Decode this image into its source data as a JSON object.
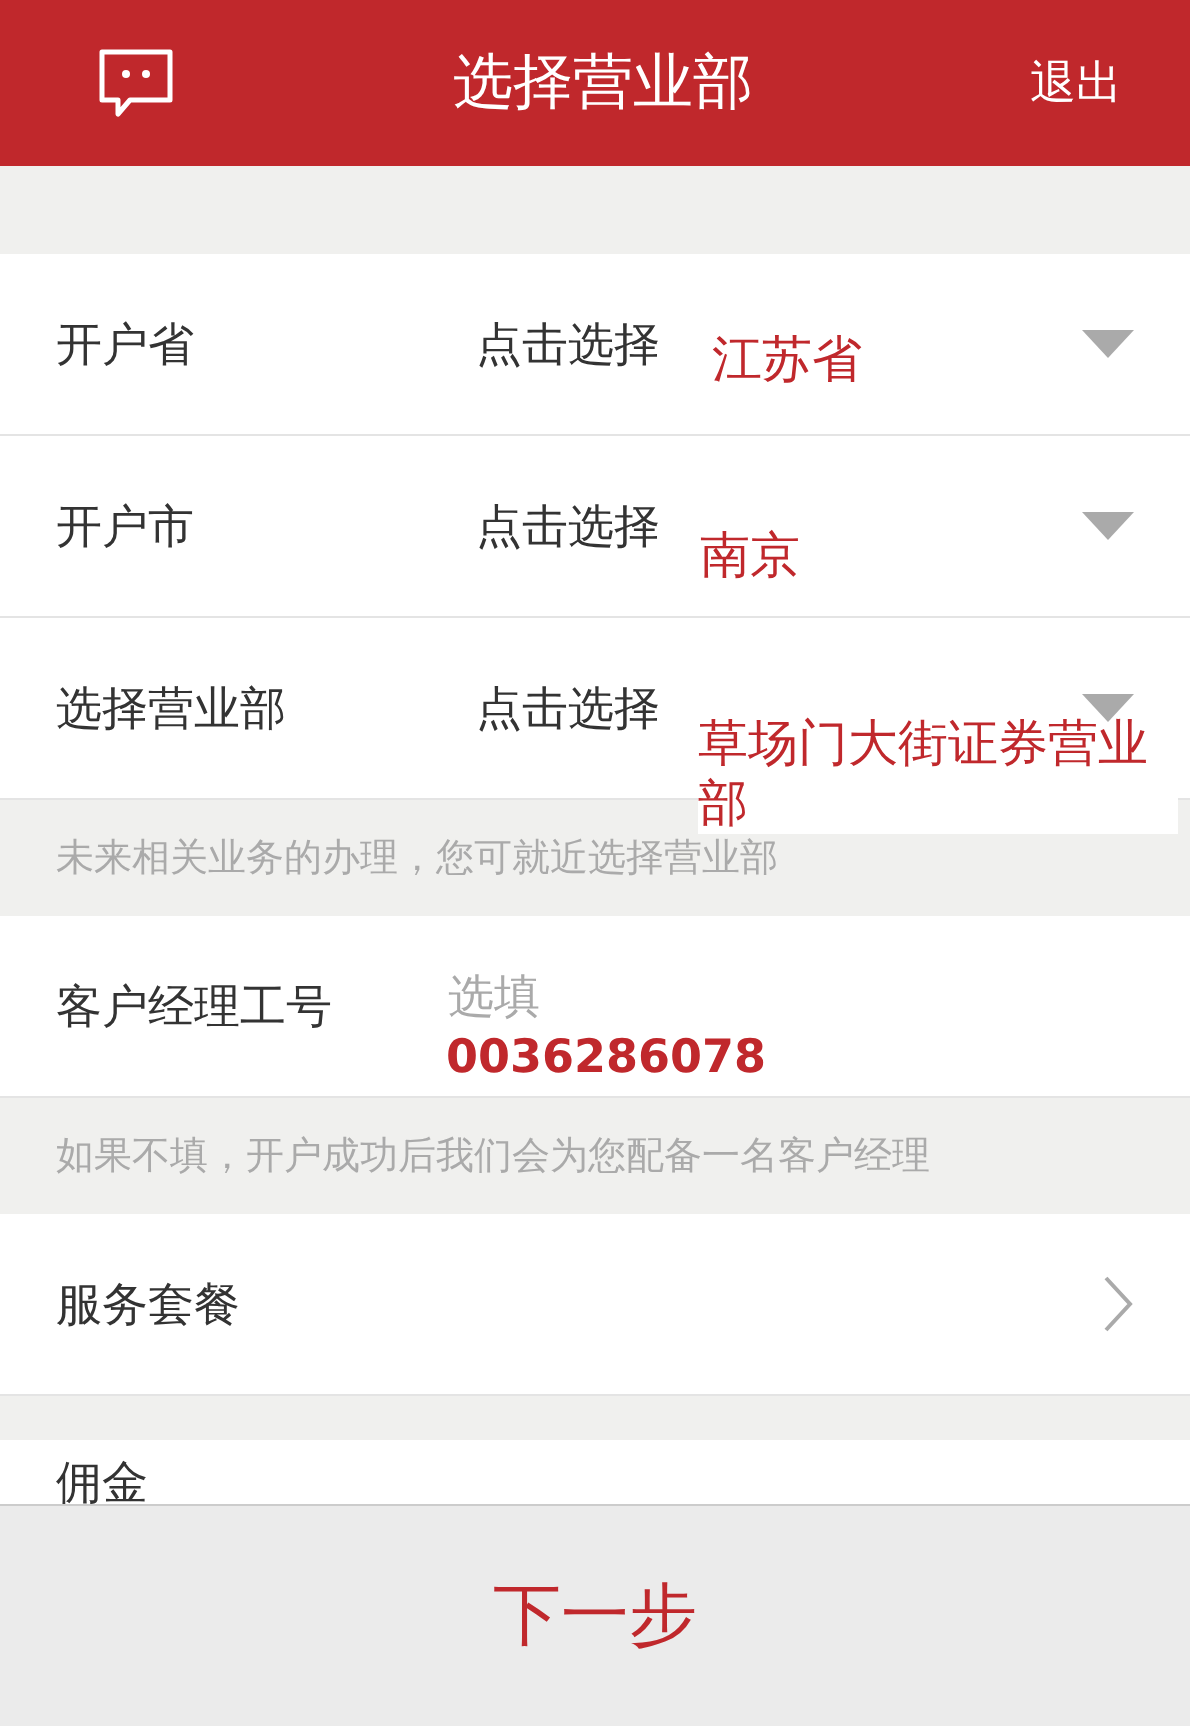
{
  "header": {
    "title": "选择营业部",
    "exit": "退出"
  },
  "selects": [
    {
      "label": "开户省",
      "placeholder": "点击选择",
      "annotation": "江苏省"
    },
    {
      "label": "开户市",
      "placeholder": "点击选择",
      "annotation": "南京"
    },
    {
      "label": "选择营业部",
      "placeholder": "点击选择",
      "annotation": "草场门大街证券营业部"
    }
  ],
  "branch_hint": "未来相关业务的办理，您可就近选择营业部",
  "manager": {
    "label": "客户经理工号",
    "placeholder": "选填",
    "annotation": "0036286078"
  },
  "manager_hint": "如果不填，开户成功后我们会为您配备一名客户经理",
  "package": {
    "label": "服务套餐"
  },
  "commission": {
    "label": "佣金"
  },
  "next_button": "下一步"
}
